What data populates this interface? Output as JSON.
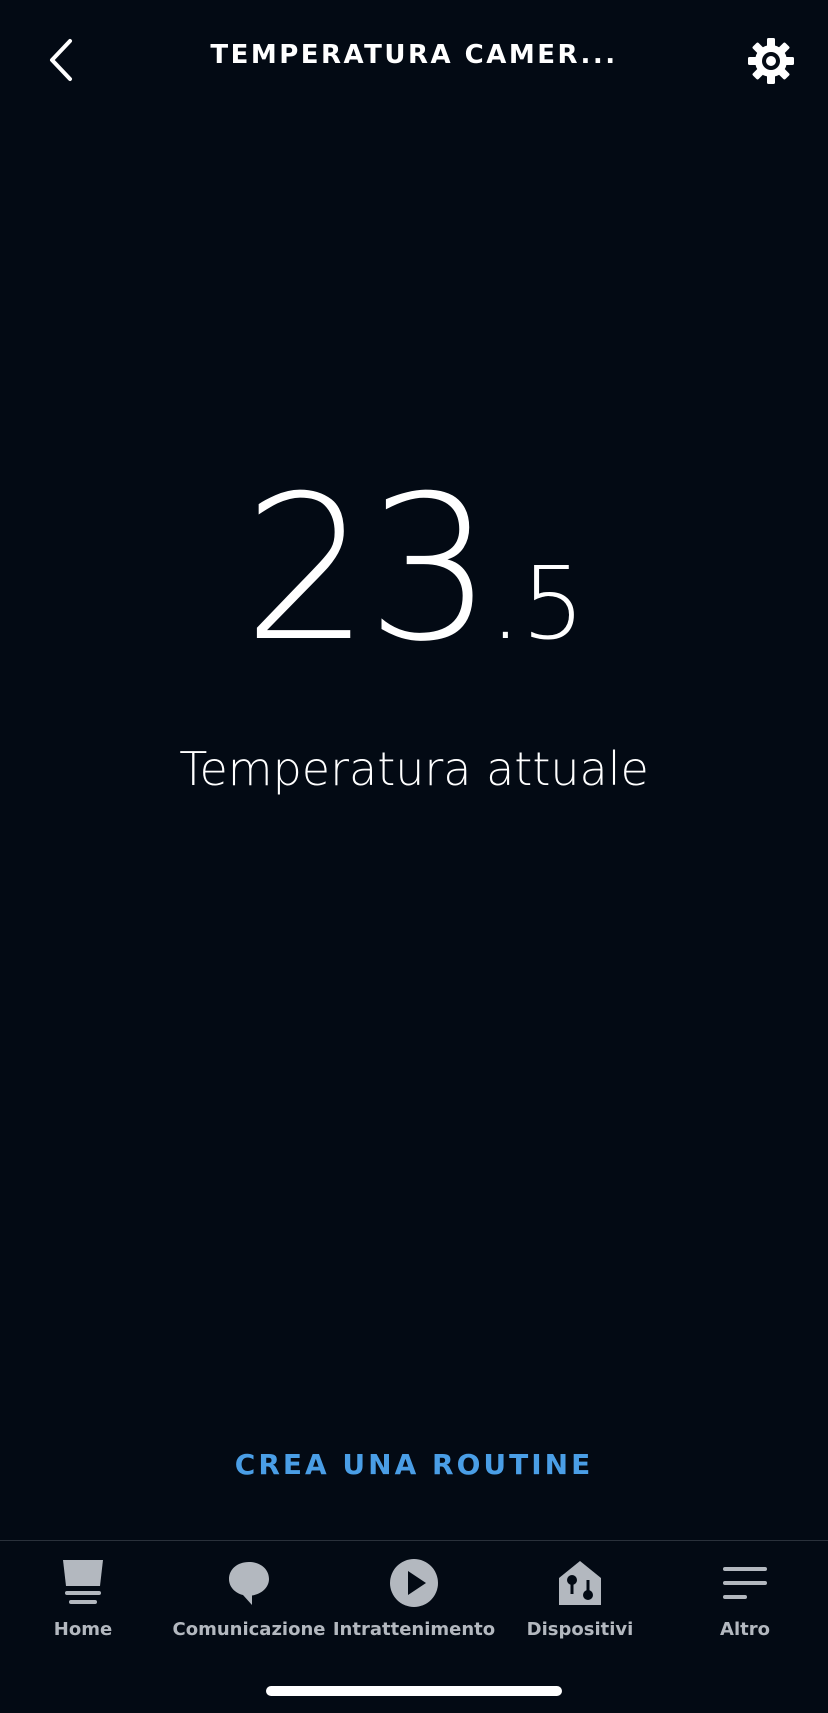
{
  "header": {
    "title": "TEMPERATURA CAMER...",
    "back_icon": "chevron-left-icon",
    "settings_icon": "gear-icon"
  },
  "temperature": {
    "integer": "23",
    "decimal": ".5",
    "label": "Temperatura attuale"
  },
  "actions": {
    "create_routine": "CREA UNA ROUTINE"
  },
  "tabbar": {
    "items": [
      {
        "label": "Home",
        "icon": "home-icon"
      },
      {
        "label": "Comunicazione",
        "icon": "chat-bubble-icon"
      },
      {
        "label": "Intrattenimento",
        "icon": "play-icon"
      },
      {
        "label": "Dispositivi",
        "icon": "devices-icon"
      },
      {
        "label": "Altro",
        "icon": "menu-icon"
      }
    ]
  },
  "colors": {
    "background": "#030a14",
    "accent": "#4a9ee6",
    "tab_inactive": "#b3b8bf"
  }
}
